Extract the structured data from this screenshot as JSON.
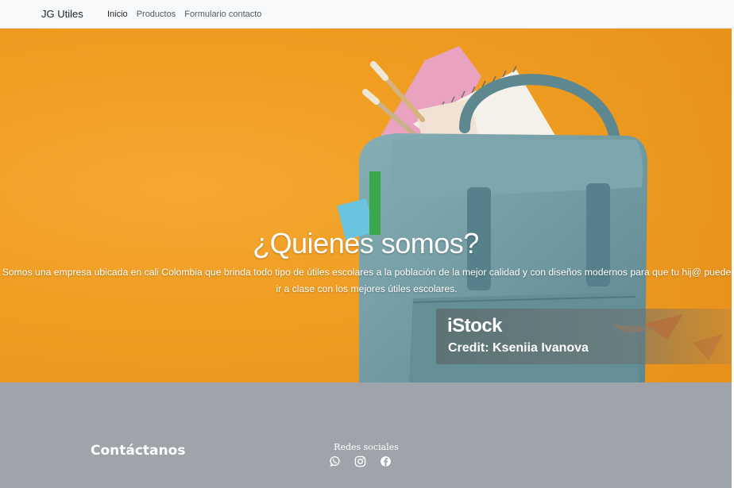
{
  "navbar": {
    "brand": "JG Utiles",
    "links": [
      {
        "label": "Inicio",
        "active": true
      },
      {
        "label": "Productos",
        "active": false
      },
      {
        "label": "Formulario contacto",
        "active": false
      }
    ]
  },
  "hero": {
    "title": "¿Quienes somos?",
    "description": "Somos una empresa ubicada en cali Colombia que brinda todo tipo de útiles escolares a la población de la mejor calidad y con diseños modernos para que tu hij@ puede ir a clase con los mejores útiles escolares.",
    "watermark_logo": "iStock",
    "watermark_credit": "Credit: Kseniia Ivanova"
  },
  "footer": {
    "contact_heading": "Contáctanos",
    "social_title": "Redes sociales",
    "social_icons": [
      "whatsapp-icon",
      "instagram-icon",
      "facebook-icon"
    ]
  },
  "colors": {
    "navbar_bg": "#f8f9fa",
    "hero_orange": "#f09e22",
    "backpack_teal": "#6f9aa2",
    "footer_bg": "#9ea4aa",
    "text_white": "#ffffff"
  }
}
